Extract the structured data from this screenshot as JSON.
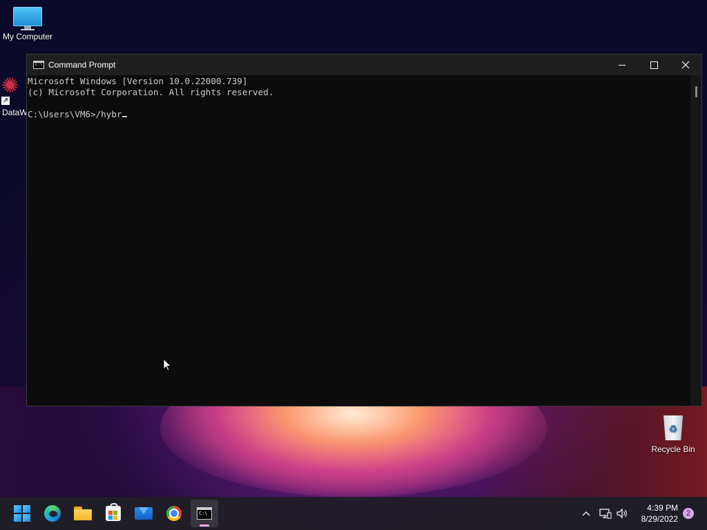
{
  "desktop": {
    "icons": [
      {
        "label": "My Computer"
      },
      {
        "label": "DataW"
      },
      {
        "label": "Recycle Bin"
      }
    ]
  },
  "window": {
    "title": "Command Prompt",
    "controls": {
      "minimize": "minimize",
      "maximize": "maximize",
      "close": "close"
    },
    "console_lines": [
      "Microsoft Windows [Version 10.0.22000.739]",
      "(c) Microsoft Corporation. All rights reserved.",
      "",
      "C:\\Users\\VM6>/hybr"
    ]
  },
  "taskbar": {
    "apps": [
      {
        "name": "start-button-icon"
      },
      {
        "name": "edge-icon"
      },
      {
        "name": "file-explorer-icon"
      },
      {
        "name": "microsoft-store-icon"
      },
      {
        "name": "mail-icon"
      },
      {
        "name": "chrome-icon"
      },
      {
        "name": "command-prompt-icon",
        "active": true
      }
    ],
    "tray": {
      "time": "4:39 PM",
      "date": "8/29/2022",
      "notification_count": "2"
    }
  },
  "colors": {
    "console_bg": "#0c0c0c",
    "console_text": "#cccccc",
    "titlebar": "#1f1f1f",
    "taskbar": "#201e26",
    "notification_badge": "#d9a6ea"
  }
}
